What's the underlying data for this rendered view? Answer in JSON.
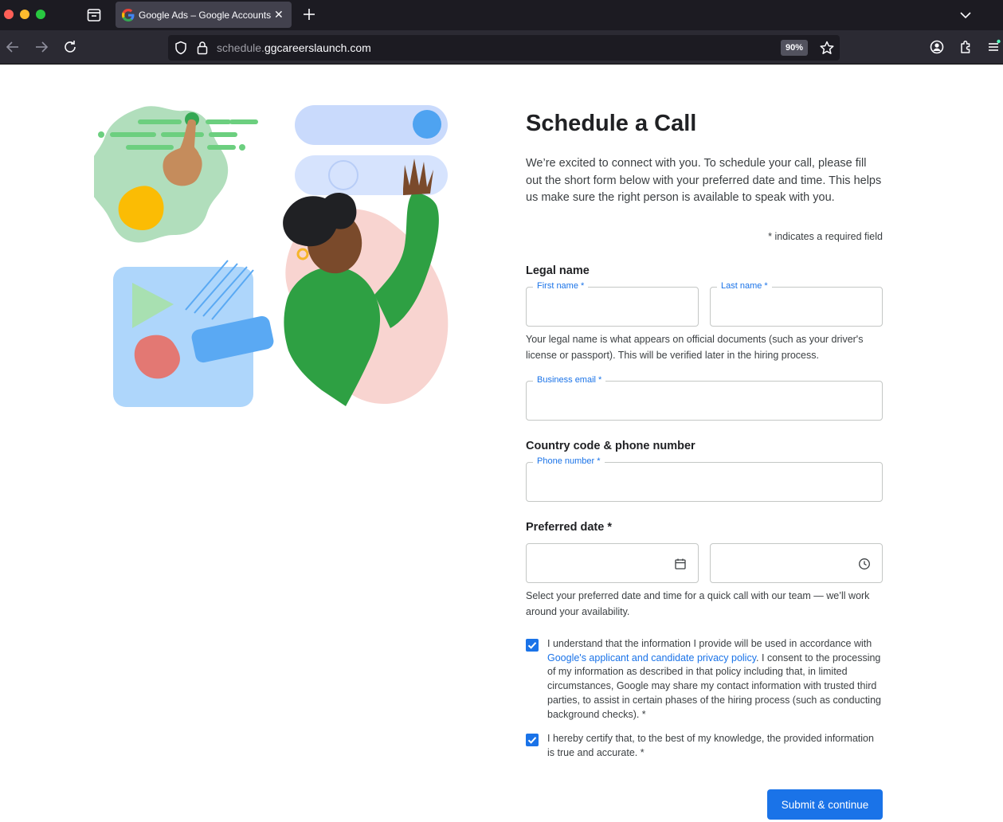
{
  "browser": {
    "tab_title": "Google Ads – Google Accounts",
    "tab_close": "✕",
    "url_subdomain": "schedule.",
    "url_domain": "ggcareerslaunch.com",
    "zoom": "90%"
  },
  "form": {
    "title": "Schedule a Call",
    "intro": "We’re excited to connect with you. To schedule your call, please fill out the short form below with your preferred date and time. This helps us make sure the right person is available to speak with you.",
    "required_note": "* indicates a required field",
    "legal_name": {
      "label": "Legal name",
      "first_name_label": "First name *",
      "first_name_value": "",
      "last_name_label": "Last name *",
      "last_name_value": "",
      "helper": "Your legal name is what appears on official documents (such as your driver's license or passport). This will be verified later in the hiring process."
    },
    "business_email": {
      "label": "Business email *",
      "value": ""
    },
    "phone": {
      "section_label": "Country code & phone number",
      "label": "Phone number *",
      "value": ""
    },
    "preferred_date": {
      "label": "Preferred date *",
      "date_value": "",
      "time_value": "",
      "helper": "Select your preferred date and time for a quick call with our team — we’ll work around your availability."
    },
    "consent_1": {
      "checked": true,
      "text_before": "I understand that the information I provide will be used in accordance with ",
      "link": "Google's applicant and candidate privacy policy",
      "text_after": ". I consent to the processing of my information as described in that policy including that, in limited circumstances, Google may share my contact information with trusted third parties, to assist in certain phases of the hiring process (such as conducting background checks). *"
    },
    "consent_2": {
      "checked": true,
      "text": "I hereby certify that, to the best of my knowledge, the provided information is true and accurate. *"
    },
    "submit_label": "Submit & continue"
  },
  "colors": {
    "accent": "#1a73e8",
    "chrome_dark": "#1c1b22",
    "chrome_toolbar": "#2b2a33"
  }
}
